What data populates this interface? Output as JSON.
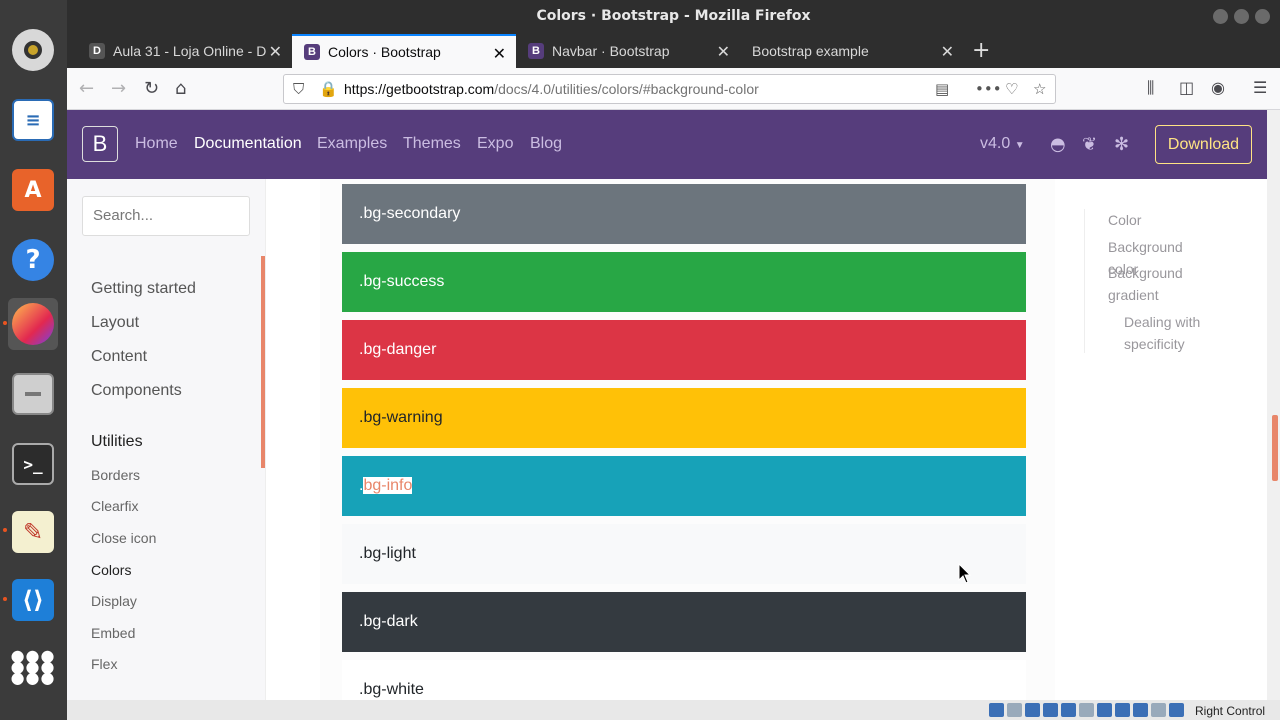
{
  "window": {
    "title": "Colors · Bootstrap - Mozilla Firefox"
  },
  "tabs": [
    {
      "label": "Aula 31 - Loja Online - D",
      "favicon": "D",
      "active": false
    },
    {
      "label": "Colors · Bootstrap",
      "favicon": "B",
      "active": true
    },
    {
      "label": "Navbar · Bootstrap",
      "favicon": "B",
      "active": false
    },
    {
      "label": "Bootstrap example",
      "favicon": "",
      "active": false
    }
  ],
  "navbar": {
    "url_host": "https://getbootstrap.com",
    "url_path": "/docs/4.0/utilities/colors/#background-color"
  },
  "site_nav": {
    "logo": "B",
    "links": [
      "Home",
      "Documentation",
      "Examples",
      "Themes",
      "Expo",
      "Blog"
    ],
    "version": "v4.0",
    "download": "Download"
  },
  "sidebar": {
    "search_placeholder": "Search...",
    "sections": [
      "Getting started",
      "Layout",
      "Content",
      "Components",
      "Utilities"
    ],
    "utilities": [
      "Borders",
      "Clearfix",
      "Close icon",
      "Colors",
      "Display",
      "Embed",
      "Flex"
    ]
  },
  "swatches": [
    {
      "label": ".bg-secondary",
      "bg": "#6c757d",
      "fg": "#ffffff"
    },
    {
      "label": ".bg-success",
      "bg": "#28a745",
      "fg": "#ffffff"
    },
    {
      "label": ".bg-danger",
      "bg": "#dc3545",
      "fg": "#ffffff"
    },
    {
      "label": ".bg-warning",
      "bg": "#ffc107",
      "fg": "#212529"
    },
    {
      "label": ".bg-info",
      "bg": "#17a2b8",
      "fg": "#ffffff"
    },
    {
      "label": ".bg-light",
      "bg": "#f8f9fa",
      "fg": "#212529"
    },
    {
      "label": ".bg-dark",
      "bg": "#343a40",
      "fg": "#ffffff"
    },
    {
      "label": ".bg-white",
      "bg": "#ffffff",
      "fg": "#212529"
    }
  ],
  "toc": [
    "Color",
    "Background color",
    "Background gradient",
    "Dealing with specificity"
  ],
  "tray": {
    "text": "Right Control"
  },
  "colors": {
    "bootstrap_purple": "#563d7c",
    "accent": "#e8866a",
    "download_yellow": "#ffe484"
  }
}
